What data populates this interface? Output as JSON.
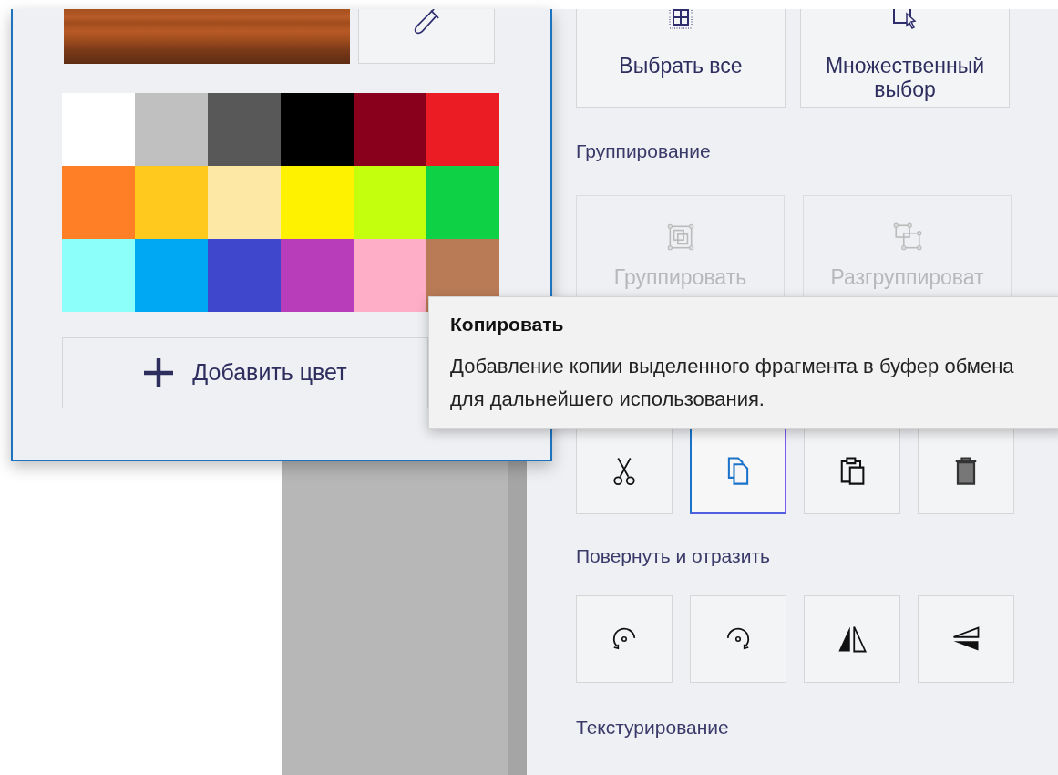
{
  "color_picker": {
    "add_color_button": "Добавить цвет",
    "palette": [
      {
        "color": "#ffffff"
      },
      {
        "color": "#c0c0c0"
      },
      {
        "color": "#585858"
      },
      {
        "color": "#000000"
      },
      {
        "color": "#88001b"
      },
      {
        "color": "#ec1c24"
      },
      {
        "color": "#ff7f27"
      },
      {
        "color": "#ffc91e"
      },
      {
        "color": "#fde8a5"
      },
      {
        "color": "#fff200"
      },
      {
        "color": "#c4ff0e"
      },
      {
        "color": "#0ed145"
      },
      {
        "color": "#8cfffb"
      },
      {
        "color": "#00a8f3"
      },
      {
        "color": "#3f48cc"
      },
      {
        "color": "#b83dba"
      },
      {
        "color": "#ffaec8"
      },
      {
        "color": "#b97a56"
      }
    ]
  },
  "side_panel": {
    "select_buttons": [
      {
        "kind": "select-all",
        "label": "Выбрать все"
      },
      {
        "kind": "multi-select",
        "label": "Множественный выбор"
      }
    ],
    "grouping_header": "Группирование",
    "grouping_buttons": [
      {
        "kind": "group",
        "label": "Группировать",
        "disabled": true
      },
      {
        "kind": "ungroup",
        "label": "Разгруппироват",
        "disabled": true
      }
    ],
    "edit_buttons": [
      {
        "kind": "cut",
        "selected": false
      },
      {
        "kind": "copy",
        "selected": true
      },
      {
        "kind": "paste",
        "selected": false
      },
      {
        "kind": "delete",
        "selected": false
      }
    ],
    "rotate_header": "Повернуть и отразить",
    "rotate_buttons": [
      {
        "kind": "rotate-left",
        "selected": false
      },
      {
        "kind": "rotate-right",
        "selected": false
      },
      {
        "kind": "flip-horizontal",
        "selected": false
      },
      {
        "kind": "flip-vertical",
        "selected": false
      }
    ],
    "texture_header": "Текстурирование"
  },
  "tooltip": {
    "title": "Копировать",
    "text": "Добавление копии выделенного фрагмента в буфер обмена для дальнейшего использования."
  }
}
